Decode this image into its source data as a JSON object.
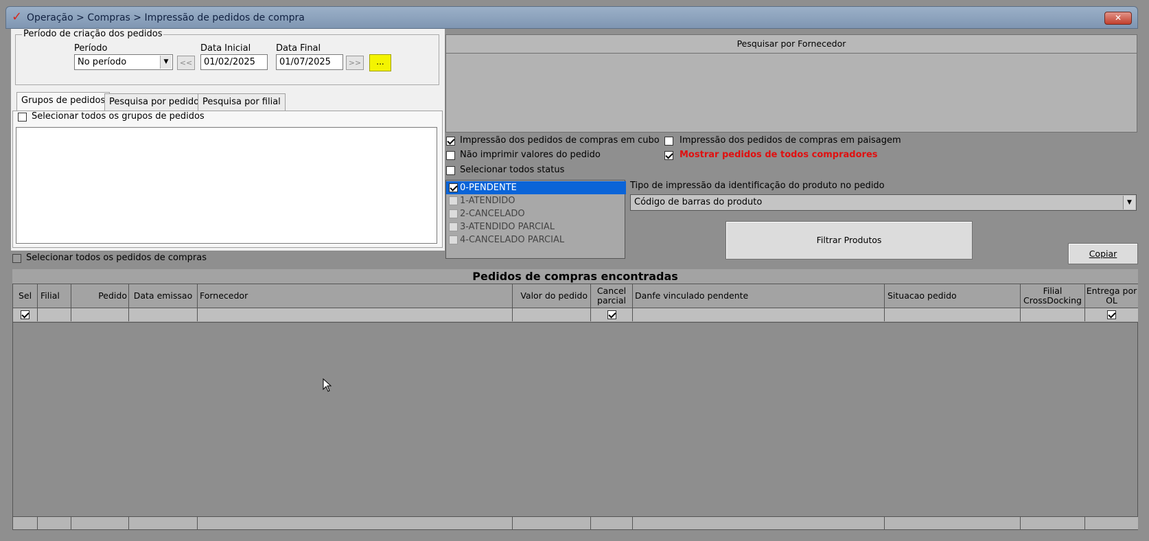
{
  "window": {
    "title": "Operação > Compras > Impressão de pedidos de compra",
    "close": "✕"
  },
  "periodo_group": {
    "legend": "Período de criação dos pedidos",
    "periodo_label": "Período",
    "periodo_value": "No período",
    "data_inicial_label": "Data Inicial",
    "data_inicial": "01/02/2025",
    "data_final_label": "Data Final",
    "data_final": "01/07/2025",
    "prev_label": "<<",
    "next_label": ">>",
    "ellipsis_label": "..."
  },
  "tabs": [
    {
      "label": "Grupos de pedidos"
    },
    {
      "label": "Pesquisa por pedido"
    },
    {
      "label": "Pesquisa por filial"
    }
  ],
  "grupos": {
    "select_all": "Selecionar todos os grupos de pedidos"
  },
  "select_all_pedidos": "Selecionar todos os pedidos de compras",
  "fornecedor": {
    "header": "Pesquisar por Fornecedor"
  },
  "options": {
    "cubo": "Impressão dos pedidos de compras em cubo",
    "paisagem": "Impressão dos pedidos de compras em paisagem",
    "nao_imprimir": "Não imprimir valores do pedido",
    "mostrar_todos": "Mostrar pedidos de todos compradores",
    "selecionar_status": "Selecionar todos status"
  },
  "status_list": [
    {
      "label": "0-PENDENTE",
      "checked": true
    },
    {
      "label": "1-ATENDIDO",
      "checked": false
    },
    {
      "label": "2-CANCELADO",
      "checked": false
    },
    {
      "label": "3-ATENDIDO PARCIAL",
      "checked": false
    },
    {
      "label": "4-CANCELADO PARCIAL",
      "checked": false
    }
  ],
  "tipo_impressao": {
    "label": "Tipo de impressão da identificação do produto no pedido",
    "value": "Código de barras do produto"
  },
  "buttons": {
    "filtrar": "Filtrar Produtos",
    "copiar": "Copiar"
  },
  "grid": {
    "title": "Pedidos de compras encontradas",
    "columns": [
      {
        "label": "Sel"
      },
      {
        "label": "Filial"
      },
      {
        "label": "Pedido"
      },
      {
        "label": "Data emissao"
      },
      {
        "label": "Fornecedor"
      },
      {
        "label": "Valor do pedido"
      },
      {
        "label": "Cancel\nparcial"
      },
      {
        "label": "Danfe vinculado pendente"
      },
      {
        "label": "Situacao pedido"
      },
      {
        "label": "Filial\nCrossDocking"
      },
      {
        "label": "Entrega por\nOL"
      }
    ]
  },
  "colors": {
    "highlight": "#0a64d8",
    "red_text": "#e01010",
    "yellow_btn": "#f4f400"
  }
}
